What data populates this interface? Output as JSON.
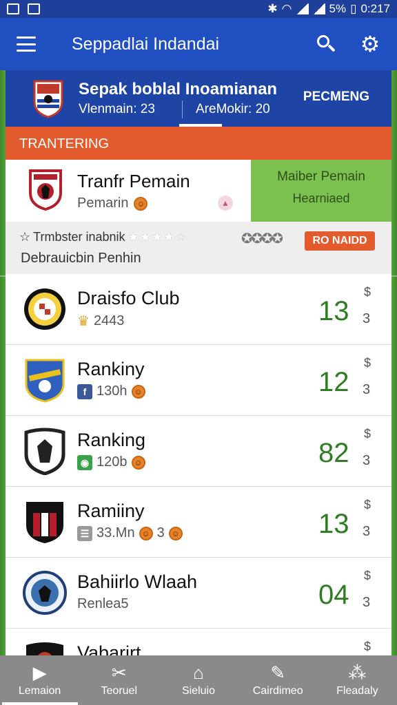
{
  "status_bar": {
    "battery": "5%",
    "time": "0:217"
  },
  "app_bar": {
    "title": "Seppadlai Indandai"
  },
  "league_header": {
    "name": "Sepak boblal Inoamianan",
    "stat_left": "Vlenmain: 23",
    "stat_right": "AreMokir: 20",
    "action": "PECMENG"
  },
  "section_banner": {
    "title": "TRANTERING"
  },
  "featured": {
    "title": "Tranfr Pemain",
    "subtitle": "Pemarin",
    "right_title": "Maiber Pemain",
    "right_subtitle": "Hearniaed"
  },
  "filter": {
    "label": "Trmbster inabnik",
    "stars": "★★★★☆",
    "stars_right": "✪✪✪✪",
    "subtitle": "Debrauicbin Penhin",
    "button": "RO NAIDD"
  },
  "clubs": [
    {
      "name": "Draisfo Club",
      "meta": "2443",
      "score": "13",
      "symbol": "$",
      "small": "3",
      "crest_color": "#c0392b"
    },
    {
      "name": "Rankiny",
      "meta": "130h",
      "score": "12",
      "symbol": "$",
      "small": "3",
      "crest_color": "#2f5fbf"
    },
    {
      "name": "Ranking",
      "meta": "120b",
      "score": "82",
      "symbol": "$",
      "small": "3",
      "crest_color": "#222222"
    },
    {
      "name": "Ramiiny",
      "meta": "33.Mn",
      "meta2": "3",
      "score": "13",
      "symbol": "$",
      "small": "3",
      "crest_color": "#b31f2a"
    },
    {
      "name": "Bahiirlo Wlaah",
      "meta": "Renlea5",
      "score": "04",
      "symbol": "$",
      "small": "3",
      "crest_color": "#3a6fb0"
    },
    {
      "name": "Vabarirt",
      "meta": "",
      "score": "",
      "symbol": "$",
      "small": "",
      "crest_color": "#c0392b"
    }
  ],
  "bottom_nav": [
    {
      "label": "Lemaion",
      "icon": "play-icon"
    },
    {
      "label": "Teoruel",
      "icon": "tools-icon"
    },
    {
      "label": "Sieluio",
      "icon": "home-icon"
    },
    {
      "label": "Cairdimeo",
      "icon": "edit-icon"
    },
    {
      "label": "Fleadaly",
      "icon": "dots-icon"
    }
  ]
}
